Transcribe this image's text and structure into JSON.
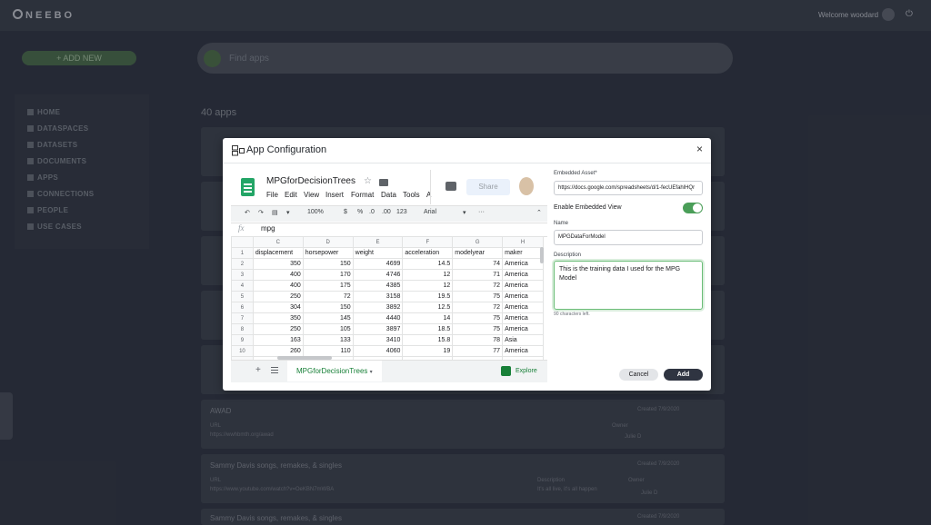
{
  "app": {
    "logo": "NEEBO",
    "welcome_prefix": "Welcome",
    "welcome_user": "woodard",
    "add_new": "+ ADD NEW",
    "search_placeholder": "Find apps",
    "apps_count": "40 apps"
  },
  "sidebar": {
    "items": [
      {
        "label": "HOME"
      },
      {
        "label": "DATASPACES"
      },
      {
        "label": "DATASETS"
      },
      {
        "label": "DOCUMENTS"
      },
      {
        "label": "APPS"
      },
      {
        "label": "CONNECTIONS"
      },
      {
        "label": "PEOPLE"
      },
      {
        "label": "USE CASES"
      }
    ]
  },
  "cards": [
    {
      "title": "AWAD",
      "url_label": "URL",
      "url": "https://wwhbmth.org/awad",
      "owner_label": "Owner",
      "owner": "Julie D",
      "created": "Created 7/9/2020"
    },
    {
      "title": "Sammy Davis songs, remakes, & singles",
      "url_label": "URL",
      "url": "https://www.youtube.com/watch?v=OeKBN7mWBA",
      "desc_label": "Description",
      "desc": "It's all live, it's all happen",
      "owner_label": "Owner",
      "owner": "Julie D",
      "created": "Created 7/9/2020"
    },
    {
      "title": "Sammy Davis songs, remakes, & singles",
      "created": "Created 7/9/2020"
    }
  ],
  "modal": {
    "title": "App Configuration",
    "close": "×",
    "sheet": {
      "file_name": "MPGforDecisionTrees",
      "menu": [
        "File",
        "Edit",
        "View",
        "Insert",
        "Format",
        "Data",
        "Tools",
        "A"
      ],
      "share": "Share",
      "toolbar": {
        "zoom": "100%",
        "currency": "$",
        "percent": "%",
        "dec_less": ".0",
        "dec_more": ".00",
        "number_format": "123",
        "font": "Arial",
        "more": "···"
      },
      "formula_value": "mpg",
      "columns": [
        "C",
        "D",
        "E",
        "F",
        "G",
        "H"
      ],
      "rows": [
        [
          "1",
          "displacement",
          "horsepower",
          "weight",
          "acceleration",
          "modelyear",
          "maker"
        ],
        [
          "2",
          "350",
          "150",
          "4699",
          "14.5",
          "74",
          "America"
        ],
        [
          "3",
          "400",
          "170",
          "4746",
          "12",
          "71",
          "America"
        ],
        [
          "4",
          "400",
          "175",
          "4385",
          "12",
          "72",
          "America"
        ],
        [
          "5",
          "250",
          "72",
          "3158",
          "19.5",
          "75",
          "America"
        ],
        [
          "6",
          "304",
          "150",
          "3892",
          "12.5",
          "72",
          "America"
        ],
        [
          "7",
          "350",
          "145",
          "4440",
          "14",
          "75",
          "America"
        ],
        [
          "8",
          "250",
          "105",
          "3897",
          "18.5",
          "75",
          "America"
        ],
        [
          "9",
          "163",
          "133",
          "3410",
          "15.8",
          "78",
          "Asia"
        ],
        [
          "10",
          "260",
          "110",
          "4060",
          "19",
          "77",
          "America"
        ],
        [
          "11",
          "",
          "",
          "",
          "",
          "",
          ""
        ]
      ],
      "sheet_tab": "MPGforDecisionTrees",
      "explore": "Explore"
    },
    "form": {
      "asset_label": "Embedded Asset*",
      "asset_value": "https://docs.google.com/spreadsheets/d/1-fecUEfahlHQr",
      "embedded_view_label": "Enable Embedded View",
      "embedded_view_on": true,
      "name_label": "Name",
      "name_value": "MPGDataForModel",
      "description_label": "Description",
      "description_value": "This is the training data I used for the MPG Model",
      "chars_left": "90 characters left.",
      "cancel": "Cancel",
      "add": "Add"
    }
  }
}
